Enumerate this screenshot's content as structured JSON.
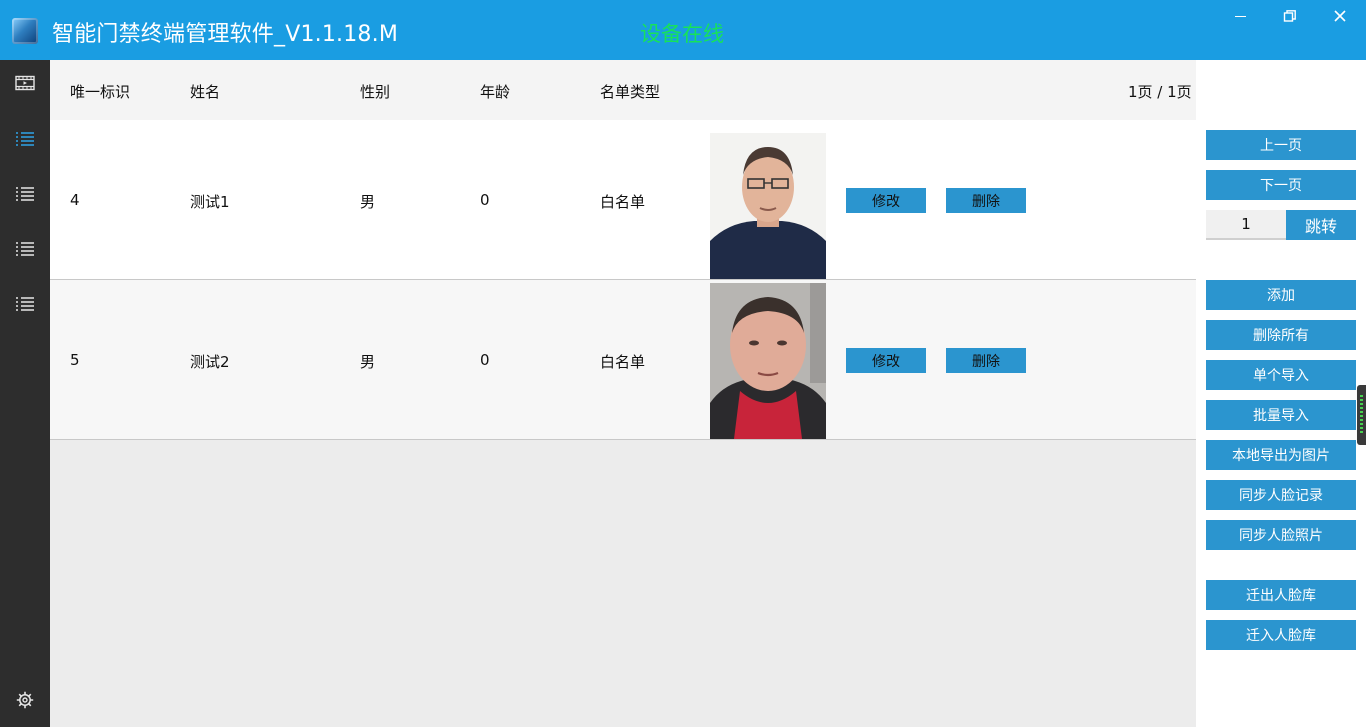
{
  "window": {
    "title": "智能门禁终端管理软件_V1.1.18.M",
    "status": "设备在线",
    "status_color": "#17e25a",
    "titlebar_color": "#1a9de2"
  },
  "sidebar": {
    "items": [
      {
        "icon": "video-icon"
      },
      {
        "icon": "list-icon",
        "active": true
      },
      {
        "icon": "list-icon"
      },
      {
        "icon": "list-icon"
      },
      {
        "icon": "list-icon"
      }
    ],
    "bottom_icon": "gear-icon"
  },
  "table": {
    "headers": {
      "id": "唯一标识",
      "name": "姓名",
      "gender": "性别",
      "age": "年龄",
      "list_type": "名单类型"
    },
    "page_info": "1页 / 1页",
    "rows": [
      {
        "id": "4",
        "name": "测试1",
        "gender": "男",
        "age": "0",
        "list_type": "白名单",
        "edit": "修改",
        "delete": "删除"
      },
      {
        "id": "5",
        "name": "测试2",
        "gender": "男",
        "age": "0",
        "list_type": "白名单",
        "edit": "修改",
        "delete": "删除"
      }
    ]
  },
  "panel": {
    "prev_page": "上一页",
    "next_page": "下一页",
    "page_input": "1",
    "jump": "跳转",
    "add": "添加",
    "delete_all": "删除所有",
    "single_import": "单个导入",
    "batch_import": "批量导入",
    "export_local_images": "本地导出为图片",
    "sync_face_records": "同步人脸记录",
    "sync_face_photos": "同步人脸照片",
    "migrate_out": "迁出人脸库",
    "migrate_in": "迁入人脸库",
    "button_color": "#2b95cf"
  }
}
